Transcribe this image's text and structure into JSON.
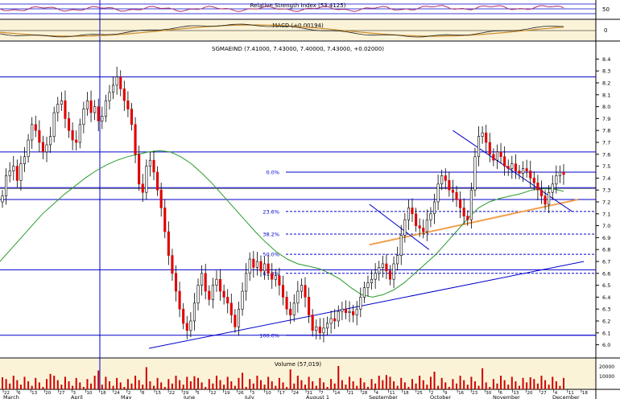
{
  "chart_data": [
    {
      "panel": "rsi",
      "type": "line",
      "title": "Relative Strength Index (53.4125)",
      "ylim": [
        0,
        100
      ],
      "y_ticks": [
        "50"
      ],
      "colors": {
        "line": "#b0306a",
        "background": "#ffffff"
      }
    },
    {
      "panel": "macd",
      "type": "line",
      "title": "MACD (+0.00194)",
      "y_ticks": [
        "0"
      ],
      "colors": {
        "macd": "#202020",
        "signal": "#c98a2a",
        "background": "#fbf3d8"
      }
    },
    {
      "panel": "price",
      "type": "candlestick",
      "title": "SGMAEIND (7.41000, 7.43000, 7.40000, 7.43000, +0.02000)",
      "ylim": [
        5.95,
        8.45
      ],
      "y_ticks": [
        "8.4",
        "8.3",
        "8.2",
        "8.1",
        "8.0",
        "7.9",
        "7.8",
        "7.7",
        "7.6",
        "7.5",
        "7.4",
        "7.3",
        "7.2",
        "7.1",
        "7.0",
        "6.9",
        "6.8",
        "6.7",
        "6.6",
        "6.5",
        "6.4",
        "6.3",
        "6.2",
        "6.1",
        "6.0"
      ],
      "x_day_labels": [
        "22",
        "6",
        "13",
        "20",
        "27",
        "3",
        "10",
        "18",
        "24",
        "2",
        "8",
        "15",
        "22",
        "29",
        "5",
        "12",
        "19",
        "26",
        "3",
        "10",
        "17",
        "24",
        "31",
        "7",
        "14",
        "21",
        "28",
        "4",
        "11",
        "18",
        "25",
        "2",
        "9",
        "16",
        "23",
        "30",
        "6",
        "13",
        "20",
        "27",
        "4",
        "11",
        "18"
      ],
      "x_month_labels": [
        "March",
        "April",
        "May",
        "June",
        "July",
        "August 1",
        "September",
        "October",
        "November",
        "December"
      ],
      "horizontal_levels": [
        8.25,
        7.62,
        7.32,
        7.22,
        6.63,
        6.08
      ],
      "fibonacci": [
        {
          "label": "0.0%",
          "value": 7.45
        },
        {
          "label": "23.6%",
          "value": 7.12
        },
        {
          "label": "38.2%",
          "value": 6.93
        },
        {
          "label": "50.0%",
          "value": 6.76
        },
        {
          "label": "61.8%",
          "value": 6.6
        },
        {
          "label": "100.0%",
          "value": 6.08
        }
      ],
      "close": [
        7.25,
        7.42,
        7.46,
        7.5,
        7.38,
        7.52,
        7.58,
        7.72,
        7.85,
        7.8,
        7.7,
        7.62,
        7.68,
        7.75,
        7.95,
        8.02,
        8.05,
        7.9,
        7.8,
        7.72,
        7.7,
        7.85,
        7.98,
        8.05,
        7.95,
        8.0,
        7.88,
        7.92,
        8.05,
        8.12,
        8.18,
        8.25,
        8.15,
        8.05,
        7.98,
        7.85,
        7.6,
        7.35,
        7.28,
        7.5,
        7.55,
        7.45,
        7.3,
        7.15,
        6.95,
        6.75,
        6.6,
        6.45,
        6.3,
        6.18,
        6.12,
        6.2,
        6.35,
        6.5,
        6.6,
        6.45,
        6.38,
        6.5,
        6.55,
        6.45,
        6.4,
        6.35,
        6.25,
        6.15,
        6.3,
        6.45,
        6.6,
        6.72,
        6.65,
        6.7,
        6.62,
        6.68,
        6.6,
        6.55,
        6.58,
        6.5,
        6.4,
        6.3,
        6.25,
        6.35,
        6.45,
        6.5,
        6.4,
        6.25,
        6.12,
        6.15,
        6.1,
        6.14,
        6.18,
        6.22,
        6.2,
        6.28,
        6.3,
        6.27,
        6.28,
        6.25,
        6.3,
        6.4,
        6.48,
        6.52,
        6.55,
        6.6,
        6.65,
        6.68,
        6.62,
        6.55,
        6.68,
        6.75,
        6.92,
        7.05,
        7.15,
        7.1,
        7.0,
        6.98,
        6.95,
        7.05,
        7.1,
        7.2,
        7.35,
        7.42,
        7.38,
        7.3,
        7.28,
        7.22,
        7.15,
        7.08,
        7.05,
        7.3,
        7.58,
        7.75,
        7.78,
        7.7,
        7.6,
        7.55,
        7.62,
        7.58,
        7.5,
        7.48,
        7.52,
        7.46,
        7.44,
        7.48,
        7.46,
        7.4,
        7.36,
        7.3,
        7.25,
        7.18,
        7.28,
        7.35,
        7.42,
        7.45,
        7.43
      ],
      "moving_average": {
        "color": "#2a9a2a",
        "values": [
          6.7,
          6.8,
          6.9,
          7.0,
          7.1,
          7.18,
          7.26,
          7.33,
          7.4,
          7.46,
          7.51,
          7.55,
          7.58,
          7.6,
          7.62,
          7.63,
          7.62,
          7.58,
          7.52,
          7.44,
          7.35,
          7.25,
          7.15,
          7.05,
          6.95,
          6.86,
          6.78,
          6.72,
          6.68,
          6.66,
          6.64,
          6.6,
          6.55,
          6.48,
          6.42,
          6.4,
          6.42,
          6.46,
          6.52,
          6.6,
          6.68,
          6.76,
          6.86,
          6.96,
          7.06,
          7.15,
          7.2,
          7.23,
          7.25,
          7.27,
          7.3,
          7.31,
          7.31,
          7.29
        ]
      },
      "trend_lines": [
        {
          "from": [
            0.25,
            5.97
          ],
          "to": [
            0.98,
            6.7
          ],
          "color": "#0000cc"
        },
        {
          "from": [
            0.62,
            6.84
          ],
          "to": [
            0.97,
            7.22
          ],
          "color": "#f0a050"
        },
        {
          "from": [
            0.76,
            7.8
          ],
          "to": [
            0.96,
            7.12
          ],
          "color": "#0000cc"
        },
        {
          "from": [
            0.62,
            7.18
          ],
          "to": [
            0.72,
            6.8
          ],
          "color": "#0000cc"
        }
      ]
    },
    {
      "panel": "volume",
      "type": "bar",
      "title": "Volume (57,019)",
      "y_ticks": [
        "20000",
        "10000"
      ],
      "colors": {
        "bars": "#d00000"
      }
    }
  ]
}
